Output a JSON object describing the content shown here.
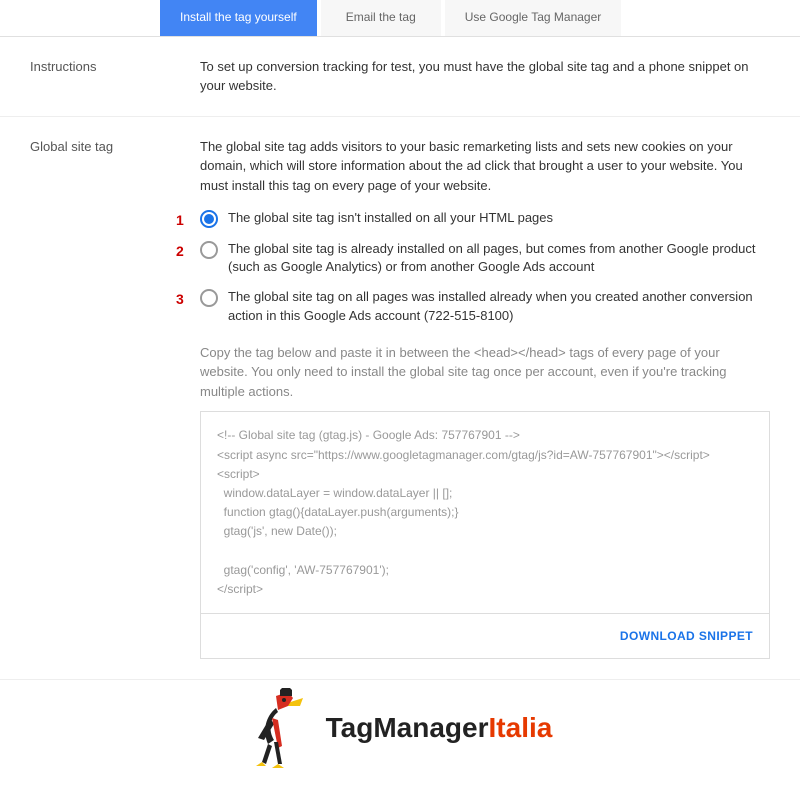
{
  "tabs": [
    {
      "label": "Install the tag yourself",
      "active": true
    },
    {
      "label": "Email the tag",
      "active": false
    },
    {
      "label": "Use Google Tag Manager",
      "active": false
    }
  ],
  "instructions": {
    "label": "Instructions",
    "text": "To set up conversion tracking for test, you must have the global site tag and a phone snippet on your website."
  },
  "global_site_tag": {
    "label": "Global site tag",
    "intro": "The global site tag adds visitors to your basic remarketing lists and sets new cookies on your domain, which will store information about the ad click that brought a user to your website. You must install this tag on every page of your website.",
    "options": [
      {
        "annot": "1",
        "label": "The global site tag isn't installed on all your HTML pages",
        "selected": true
      },
      {
        "annot": "2",
        "label": "The global site tag is already installed on all pages, but comes from another Google product (such as Google Analytics) or from another Google Ads account",
        "selected": false
      },
      {
        "annot": "3",
        "label": "The global site tag on all pages was installed already when you created another conversion action in this Google Ads account (722-515-8100)",
        "selected": false
      }
    ],
    "copy_text": "Copy the tag below and paste it in between the <head></head> tags of every page of your website. You only need to install the global site tag once per account, even if you're tracking multiple actions.",
    "code": "<!-- Global site tag (gtag.js) - Google Ads: 757767901 -->\n<script async src=\"https://www.googletagmanager.com/gtag/js?id=AW-757767901\"></script>\n<script>\n  window.dataLayer = window.dataLayer || [];\n  function gtag(){dataLayer.push(arguments);}\n  gtag('js', new Date());\n\n  gtag('config', 'AW-757767901');\n</script>",
    "download_label": "DOWNLOAD SNIPPET"
  },
  "logo": {
    "part1": "TagManager",
    "part2": "Italia"
  }
}
